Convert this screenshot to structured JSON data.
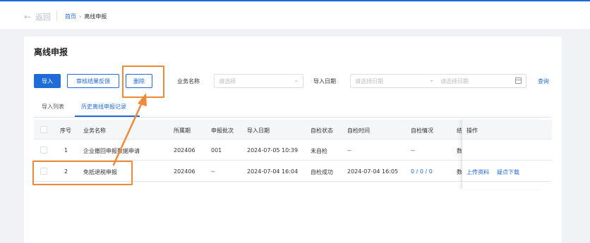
{
  "topbar": {
    "back_label": "返回",
    "crumb_home": "首页",
    "crumb_sep": "›",
    "crumb_current": "离线申报"
  },
  "page": {
    "title": "离线申报"
  },
  "toolbar": {
    "import_label": "导入",
    "feedback_label": "审核结果反馈",
    "delete_label": "删除",
    "business_label": "业务名称",
    "business_placeholder": "请选择",
    "date_label": "导入日期",
    "start_placeholder": "请选择日期",
    "date_sep": "-",
    "end_placeholder": "请选择日期",
    "query_label": "查询"
  },
  "tabs": [
    {
      "label": "导入列表"
    },
    {
      "label": "历史离线申报记录"
    }
  ],
  "table": {
    "columns": [
      "序号",
      "业务名称",
      "所属期",
      "申报批次",
      "导入日期",
      "自检状态",
      "自检时间",
      "自检情况",
      "结果信息",
      "操作"
    ],
    "rows": [
      {
        "index": "1",
        "name": "企业撤回申报数据申请",
        "period": "202406",
        "batch": "001",
        "import_date": "2024-07-05 10:39",
        "check_status": "未自检",
        "check_time": "--",
        "check_result": "--",
        "result_info": "数据提",
        "actions": []
      },
      {
        "index": "2",
        "name": "免抵退税申报",
        "period": "202406",
        "batch": "--",
        "import_date": "2024-07-04 16:04",
        "check_status": "自检成功",
        "check_time": "2024-07-04 16:05",
        "check_result": "0 / 0 / 0",
        "result_info": "数据提",
        "actions": [
          "上传资料",
          "疑点下载"
        ]
      }
    ]
  },
  "colors": {
    "primary": "#1f6bd8",
    "highlight": "#f08a3a"
  },
  "icons": {
    "back": "arrow-left-icon",
    "select": "chevron-down-icon",
    "date": "calendar-icon"
  }
}
